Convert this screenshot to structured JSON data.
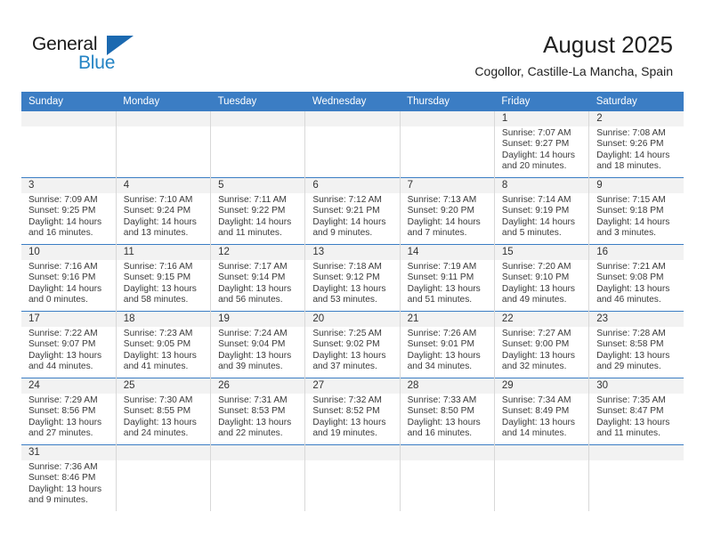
{
  "logo": {
    "word_top": "General",
    "word_bottom": "Blue",
    "flag_icon": "blue-triangle-flag",
    "color_top": "#1a1a1a",
    "color_bottom": "#2383c4"
  },
  "header": {
    "title": "August 2025",
    "subtitle": "Cogollor, Castille-La Mancha, Spain"
  },
  "colors": {
    "header_blue": "#3b7dc4",
    "daynum_band": "#f2f2f2",
    "grid_line": "#d8d8d8",
    "text": "#3a3a3a"
  },
  "weekday_headers": [
    "Sunday",
    "Monday",
    "Tuesday",
    "Wednesday",
    "Thursday",
    "Friday",
    "Saturday"
  ],
  "weeks": [
    [
      {
        "day": "",
        "sunrise": "",
        "sunset": "",
        "daylight1": "",
        "daylight2": ""
      },
      {
        "day": "",
        "sunrise": "",
        "sunset": "",
        "daylight1": "",
        "daylight2": ""
      },
      {
        "day": "",
        "sunrise": "",
        "sunset": "",
        "daylight1": "",
        "daylight2": ""
      },
      {
        "day": "",
        "sunrise": "",
        "sunset": "",
        "daylight1": "",
        "daylight2": ""
      },
      {
        "day": "",
        "sunrise": "",
        "sunset": "",
        "daylight1": "",
        "daylight2": ""
      },
      {
        "day": "1",
        "sunrise": "Sunrise: 7:07 AM",
        "sunset": "Sunset: 9:27 PM",
        "daylight1": "Daylight: 14 hours",
        "daylight2": "and 20 minutes."
      },
      {
        "day": "2",
        "sunrise": "Sunrise: 7:08 AM",
        "sunset": "Sunset: 9:26 PM",
        "daylight1": "Daylight: 14 hours",
        "daylight2": "and 18 minutes."
      }
    ],
    [
      {
        "day": "3",
        "sunrise": "Sunrise: 7:09 AM",
        "sunset": "Sunset: 9:25 PM",
        "daylight1": "Daylight: 14 hours",
        "daylight2": "and 16 minutes."
      },
      {
        "day": "4",
        "sunrise": "Sunrise: 7:10 AM",
        "sunset": "Sunset: 9:24 PM",
        "daylight1": "Daylight: 14 hours",
        "daylight2": "and 13 minutes."
      },
      {
        "day": "5",
        "sunrise": "Sunrise: 7:11 AM",
        "sunset": "Sunset: 9:22 PM",
        "daylight1": "Daylight: 14 hours",
        "daylight2": "and 11 minutes."
      },
      {
        "day": "6",
        "sunrise": "Sunrise: 7:12 AM",
        "sunset": "Sunset: 9:21 PM",
        "daylight1": "Daylight: 14 hours",
        "daylight2": "and 9 minutes."
      },
      {
        "day": "7",
        "sunrise": "Sunrise: 7:13 AM",
        "sunset": "Sunset: 9:20 PM",
        "daylight1": "Daylight: 14 hours",
        "daylight2": "and 7 minutes."
      },
      {
        "day": "8",
        "sunrise": "Sunrise: 7:14 AM",
        "sunset": "Sunset: 9:19 PM",
        "daylight1": "Daylight: 14 hours",
        "daylight2": "and 5 minutes."
      },
      {
        "day": "9",
        "sunrise": "Sunrise: 7:15 AM",
        "sunset": "Sunset: 9:18 PM",
        "daylight1": "Daylight: 14 hours",
        "daylight2": "and 3 minutes."
      }
    ],
    [
      {
        "day": "10",
        "sunrise": "Sunrise: 7:16 AM",
        "sunset": "Sunset: 9:16 PM",
        "daylight1": "Daylight: 14 hours",
        "daylight2": "and 0 minutes."
      },
      {
        "day": "11",
        "sunrise": "Sunrise: 7:16 AM",
        "sunset": "Sunset: 9:15 PM",
        "daylight1": "Daylight: 13 hours",
        "daylight2": "and 58 minutes."
      },
      {
        "day": "12",
        "sunrise": "Sunrise: 7:17 AM",
        "sunset": "Sunset: 9:14 PM",
        "daylight1": "Daylight: 13 hours",
        "daylight2": "and 56 minutes."
      },
      {
        "day": "13",
        "sunrise": "Sunrise: 7:18 AM",
        "sunset": "Sunset: 9:12 PM",
        "daylight1": "Daylight: 13 hours",
        "daylight2": "and 53 minutes."
      },
      {
        "day": "14",
        "sunrise": "Sunrise: 7:19 AM",
        "sunset": "Sunset: 9:11 PM",
        "daylight1": "Daylight: 13 hours",
        "daylight2": "and 51 minutes."
      },
      {
        "day": "15",
        "sunrise": "Sunrise: 7:20 AM",
        "sunset": "Sunset: 9:10 PM",
        "daylight1": "Daylight: 13 hours",
        "daylight2": "and 49 minutes."
      },
      {
        "day": "16",
        "sunrise": "Sunrise: 7:21 AM",
        "sunset": "Sunset: 9:08 PM",
        "daylight1": "Daylight: 13 hours",
        "daylight2": "and 46 minutes."
      }
    ],
    [
      {
        "day": "17",
        "sunrise": "Sunrise: 7:22 AM",
        "sunset": "Sunset: 9:07 PM",
        "daylight1": "Daylight: 13 hours",
        "daylight2": "and 44 minutes."
      },
      {
        "day": "18",
        "sunrise": "Sunrise: 7:23 AM",
        "sunset": "Sunset: 9:05 PM",
        "daylight1": "Daylight: 13 hours",
        "daylight2": "and 41 minutes."
      },
      {
        "day": "19",
        "sunrise": "Sunrise: 7:24 AM",
        "sunset": "Sunset: 9:04 PM",
        "daylight1": "Daylight: 13 hours",
        "daylight2": "and 39 minutes."
      },
      {
        "day": "20",
        "sunrise": "Sunrise: 7:25 AM",
        "sunset": "Sunset: 9:02 PM",
        "daylight1": "Daylight: 13 hours",
        "daylight2": "and 37 minutes."
      },
      {
        "day": "21",
        "sunrise": "Sunrise: 7:26 AM",
        "sunset": "Sunset: 9:01 PM",
        "daylight1": "Daylight: 13 hours",
        "daylight2": "and 34 minutes."
      },
      {
        "day": "22",
        "sunrise": "Sunrise: 7:27 AM",
        "sunset": "Sunset: 9:00 PM",
        "daylight1": "Daylight: 13 hours",
        "daylight2": "and 32 minutes."
      },
      {
        "day": "23",
        "sunrise": "Sunrise: 7:28 AM",
        "sunset": "Sunset: 8:58 PM",
        "daylight1": "Daylight: 13 hours",
        "daylight2": "and 29 minutes."
      }
    ],
    [
      {
        "day": "24",
        "sunrise": "Sunrise: 7:29 AM",
        "sunset": "Sunset: 8:56 PM",
        "daylight1": "Daylight: 13 hours",
        "daylight2": "and 27 minutes."
      },
      {
        "day": "25",
        "sunrise": "Sunrise: 7:30 AM",
        "sunset": "Sunset: 8:55 PM",
        "daylight1": "Daylight: 13 hours",
        "daylight2": "and 24 minutes."
      },
      {
        "day": "26",
        "sunrise": "Sunrise: 7:31 AM",
        "sunset": "Sunset: 8:53 PM",
        "daylight1": "Daylight: 13 hours",
        "daylight2": "and 22 minutes."
      },
      {
        "day": "27",
        "sunrise": "Sunrise: 7:32 AM",
        "sunset": "Sunset: 8:52 PM",
        "daylight1": "Daylight: 13 hours",
        "daylight2": "and 19 minutes."
      },
      {
        "day": "28",
        "sunrise": "Sunrise: 7:33 AM",
        "sunset": "Sunset: 8:50 PM",
        "daylight1": "Daylight: 13 hours",
        "daylight2": "and 16 minutes."
      },
      {
        "day": "29",
        "sunrise": "Sunrise: 7:34 AM",
        "sunset": "Sunset: 8:49 PM",
        "daylight1": "Daylight: 13 hours",
        "daylight2": "and 14 minutes."
      },
      {
        "day": "30",
        "sunrise": "Sunrise: 7:35 AM",
        "sunset": "Sunset: 8:47 PM",
        "daylight1": "Daylight: 13 hours",
        "daylight2": "and 11 minutes."
      }
    ],
    [
      {
        "day": "31",
        "sunrise": "Sunrise: 7:36 AM",
        "sunset": "Sunset: 8:46 PM",
        "daylight1": "Daylight: 13 hours",
        "daylight2": "and 9 minutes."
      },
      {
        "day": "",
        "sunrise": "",
        "sunset": "",
        "daylight1": "",
        "daylight2": ""
      },
      {
        "day": "",
        "sunrise": "",
        "sunset": "",
        "daylight1": "",
        "daylight2": ""
      },
      {
        "day": "",
        "sunrise": "",
        "sunset": "",
        "daylight1": "",
        "daylight2": ""
      },
      {
        "day": "",
        "sunrise": "",
        "sunset": "",
        "daylight1": "",
        "daylight2": ""
      },
      {
        "day": "",
        "sunrise": "",
        "sunset": "",
        "daylight1": "",
        "daylight2": ""
      },
      {
        "day": "",
        "sunrise": "",
        "sunset": "",
        "daylight1": "",
        "daylight2": ""
      }
    ]
  ]
}
